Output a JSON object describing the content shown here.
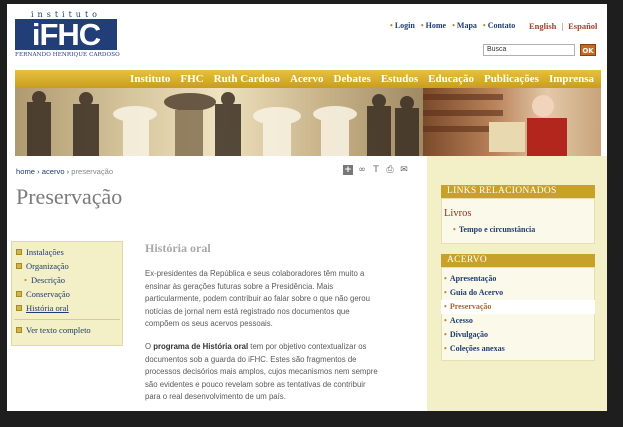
{
  "logo": {
    "instituto": "instituto",
    "ifhc": "iFHC",
    "name": "Fernando Henrique Cardoso"
  },
  "toplinks": [
    "Login",
    "Home",
    "Mapa",
    "Contato"
  ],
  "languages": [
    "English",
    "Español"
  ],
  "search": {
    "placeholder": "Busca",
    "button": "OK"
  },
  "nav": [
    "Instituto",
    "FHC",
    "Ruth Cardoso",
    "Acervo",
    "Debates",
    "Estudos",
    "Educação",
    "Publicações",
    "Imprensa"
  ],
  "breadcrumb": {
    "home": "home",
    "acervo": "acervo",
    "current": "preservação"
  },
  "page_title": "Preservação",
  "left_menu": {
    "items": [
      "Instalações",
      "Organização",
      "Descrição",
      "Conservação",
      "História oral"
    ],
    "footer": "Ver texto completo"
  },
  "main": {
    "subtitle": "História oral",
    "para1": "Ex-presidentes da República e seus colaboradores têm muito a ensinar às gerações futuras sobre a Presidência. Mais particularmente, podem contribuir ao falar sobre o que não gerou notícias de jornal nem está registrado nos documentos que compõem os seus acervos pessoais.",
    "para2_pre": "O ",
    "para2_bold": "programa de História oral",
    "para2_post": " tem por objetivo contextualizar os documentos sob a guarda do iFHC. Estes são fragmentos de processos decisórios mais amplos, cujos mecanismos nem sempre são evidentes e pouco revelam sobre as tentativas de contribuir para o real desenvolvimento de um país."
  },
  "right": {
    "links_header": "LINKS RELACIONADOS",
    "livros": "Livros",
    "tempo": "Tempo e circunstância",
    "acervo_header": "ACERVO",
    "acervo_items": [
      "Apresentação",
      "Guia do Acervo",
      "Preservação",
      "Acesso",
      "Divulgação",
      "Coleções anexas"
    ]
  },
  "colors": {
    "nav_gold": "#d3ac2c",
    "brand_blue": "#223e78",
    "accent_red": "#9c2a1a",
    "panel_cream": "#f3efc6"
  }
}
